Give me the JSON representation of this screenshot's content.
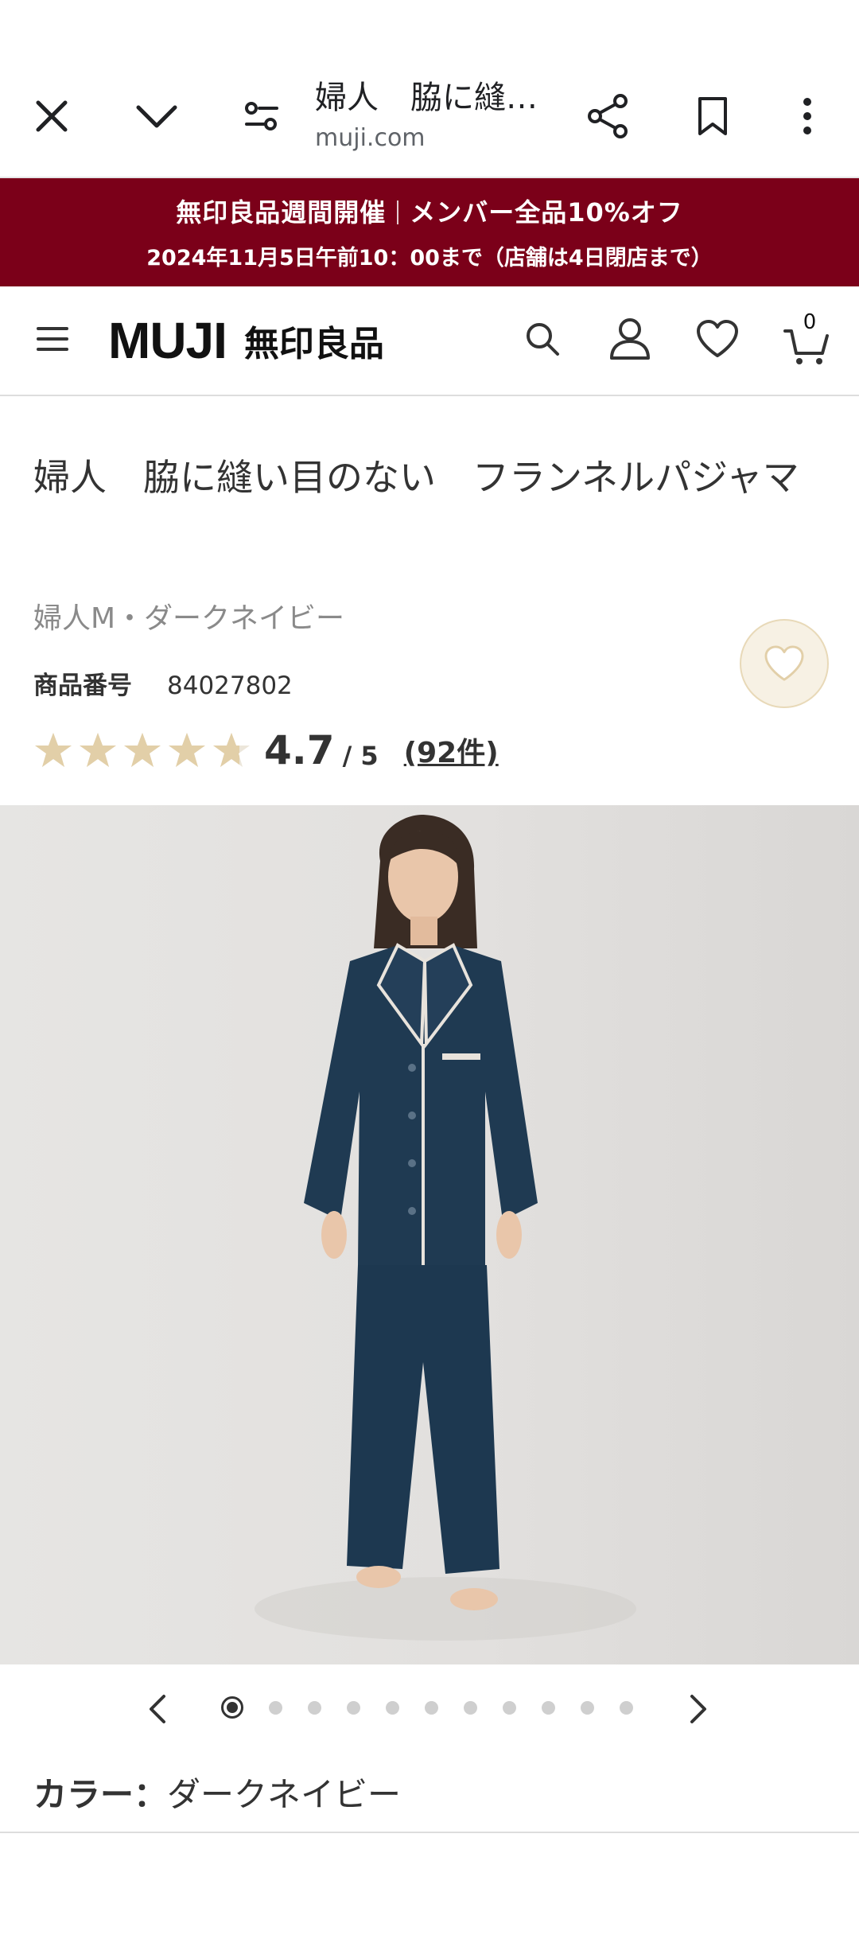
{
  "browser": {
    "tab_title": "婦人　脇に縫…",
    "url": "muji.com"
  },
  "promo": {
    "line1_a": "無印良品週間開催",
    "line1_b": "メンバー全品10%オフ",
    "line2": "2024年11月5日午前10：00まで（店舗は4日閉店まで）",
    "color": "#7b0019"
  },
  "header": {
    "logo_en": "MUJI",
    "logo_jp": "無印良品",
    "cart_count": "0"
  },
  "product": {
    "title": "婦人　脇に縫い目のない　フランネルパジャマ",
    "variant": "婦人M・ダークネイビー",
    "code_label": "商品番号",
    "code": "84027802",
    "rating": "4.7",
    "rating_max": "/ 5",
    "review_count": "(92件)",
    "stars_filled": 4.7,
    "star_color": "#e2cfa8"
  },
  "carousel": {
    "total_images": 11,
    "current_index": 1
  },
  "color": {
    "label": "カラー：",
    "value": "ダークネイビー"
  }
}
